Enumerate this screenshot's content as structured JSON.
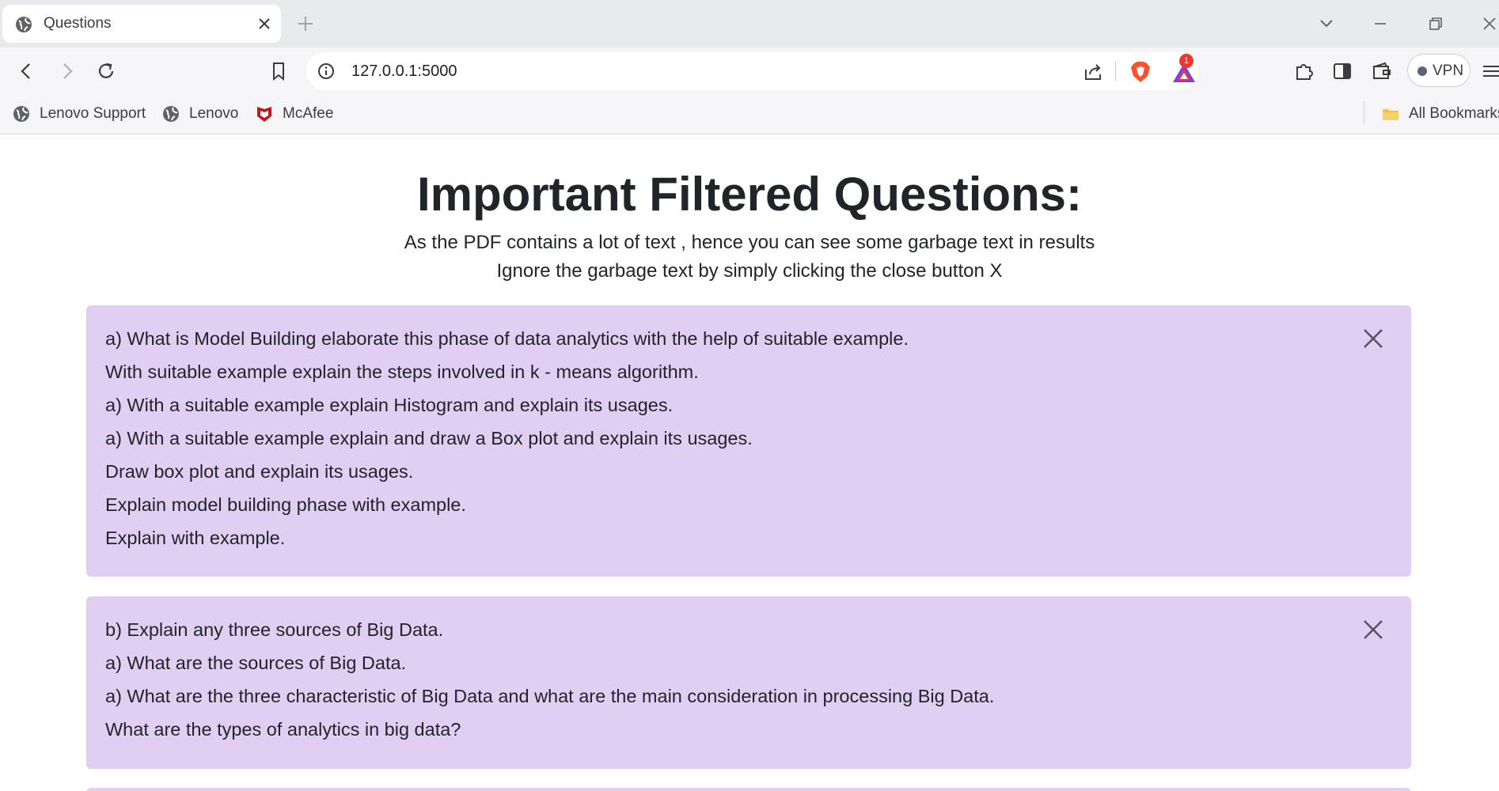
{
  "browser": {
    "tab_title": "Questions",
    "url": "127.0.0.1:5000",
    "rewards_badge": "1",
    "vpn_label": "VPN",
    "bookmarks": [
      {
        "label": "Lenovo Support",
        "icon": "globe-icon"
      },
      {
        "label": "Lenovo",
        "icon": "globe-icon"
      },
      {
        "label": "McAfee",
        "icon": "mcafee-shield-icon"
      }
    ],
    "all_bookmarks_label": "All Bookmarks"
  },
  "page": {
    "heading": "Important Filtered Questions:",
    "subtitle_line1": "As the PDF contains a lot of text , hence you can see some garbage text in results",
    "subtitle_line2": "Ignore the garbage text by simply clicking the close button X",
    "card_color": "#e0cff2",
    "cards": [
      {
        "questions": [
          "a) What is Model Building elaborate this phase of data analytics with the help of suitable example.",
          "With suitable example explain the steps involved in k - means algorithm.",
          "a) With a suitable example explain Histogram and explain its usages.",
          "a) With a suitable example explain and draw a Box plot and explain its usages.",
          "Draw box plot and explain its usages.",
          "Explain model building phase with example.",
          "Explain with example."
        ]
      },
      {
        "questions": [
          "b) Explain any three sources of Big Data.",
          "a) What are the sources of Big Data.",
          "a) What are the three characteristic of Big Data and what are the main consideration in processing Big Data.",
          "What are the types of analytics in big data?"
        ]
      }
    ]
  }
}
